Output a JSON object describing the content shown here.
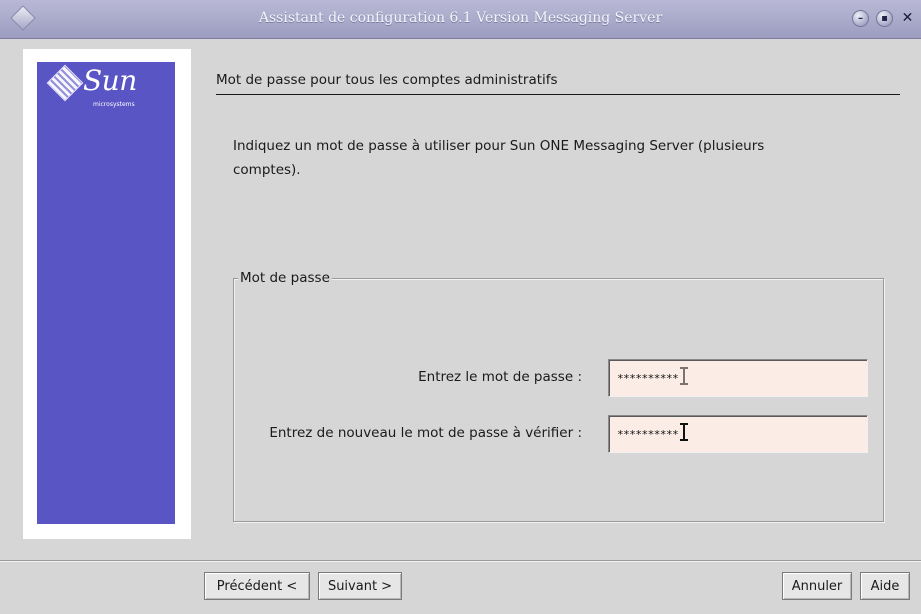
{
  "window": {
    "title": "Assistant de configuration 6.1 Version Messaging Server",
    "controls": [
      "minimize-icon",
      "maximize-icon",
      "close-icon"
    ]
  },
  "sidebar": {
    "logo_text": "Sun",
    "logo_sub": "microsystems",
    "color": "#5a55c4"
  },
  "main": {
    "heading": "Mot de passe pour tous les comptes administratifs",
    "description": "Indiquez un mot de passe à utiliser pour Sun ONE Messaging Server (plusieurs comptes).",
    "group_label": "Mot de passe",
    "fields": [
      {
        "label": "Entrez le mot de passe :",
        "value": "**********"
      },
      {
        "label": "Entrez de nouveau le mot de passe à vérifier :",
        "value": "**********"
      }
    ]
  },
  "buttons": {
    "previous": "Précédent <",
    "next": "Suivant >",
    "cancel": "Annuler",
    "help": "Aide"
  }
}
